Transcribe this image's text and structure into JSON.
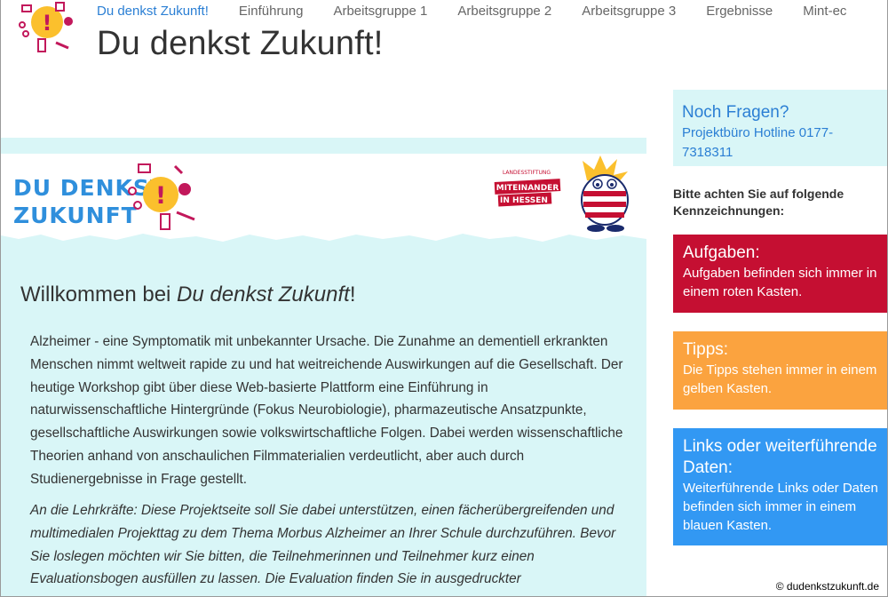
{
  "nav": {
    "items": [
      {
        "label": "Du denkst Zukunft!",
        "active": true
      },
      {
        "label": "Einführung"
      },
      {
        "label": "Arbeitsgruppe 1"
      },
      {
        "label": "Arbeitsgruppe 2"
      },
      {
        "label": "Arbeitsgruppe 3"
      },
      {
        "label": "Ergebnisse"
      },
      {
        "label": "Mint-ec"
      }
    ]
  },
  "header": {
    "title": "Du denkst Zukunft!"
  },
  "banner": {
    "logo_line1": "DU DENKST",
    "logo_line2": "ZUKUNFT",
    "partner_small": "LANDESSTIFTUNG",
    "partner_line1": "MITEINANDER",
    "partner_line2": "IN HESSEN"
  },
  "main": {
    "welcome_prefix": "Willkommen bei ",
    "welcome_em": "Du denkst Zukunft",
    "welcome_suffix": "!",
    "paragraph1": "Alzheimer - eine Symptomatik mit unbekannter Ursache. Die Zunahme an dementiell erkrankten Menschen nimmt weltweit rapide zu und hat weitreichende Auswirkungen auf die Gesellschaft. Der heutige Workshop gibt über diese Web-basierte Plattform eine Einführung in naturwissenschaftliche Hintergründe (Fokus Neurobiologie), pharmazeutische Ansatzpunkte, gesellschaftliche Auswirkungen sowie volkswirtschaftliche Folgen. Dabei werden wissenschaftliche Theorien anhand von anschaulichen Filmmaterialien verdeutlicht, aber auch durch Studienergebnisse in Frage gestellt.",
    "paragraph2": "An die Lehrkräfte: Diese Projektseite soll Sie dabei unterstützen, einen fächerübergreifenden und multimedialen Projekttag zu dem Thema Morbus Alzheimer an Ihrer Schule durchzuführen. Bevor Sie loslegen möchten wir Sie bitten, die Teilnehmerinnen und Teilnehmer kurz einen Evaluationsbogen ausfüllen zu lassen. Die Evaluation finden Sie in ausgedruckter"
  },
  "sidebar": {
    "faq_title": "Noch Fragen?",
    "faq_text": "Projektbüro Hotline 0177-7318311",
    "note": "Bitte achten Sie auf folgende Kennzeichnungen:",
    "boxes": [
      {
        "title": "Aufgaben:",
        "text": "Aufgaben befinden sich immer in einem roten Kasten.",
        "color": "#c50f32"
      },
      {
        "title": "Tipps:",
        "text": "Die Tipps stehen immer in einem gelben Kasten.",
        "color": "#fba33f"
      },
      {
        "title": "Links oder weiterführende Daten:",
        "text": "Weiterführende Links oder Daten befinden sich immer in einem blauen Kasten.",
        "color": "#3298f3"
      }
    ]
  },
  "footer": {
    "copyright": "© dudenkstzukunft.de"
  },
  "colors": {
    "accent": "#2b7fd4",
    "light_cyan": "#d9f6f7"
  }
}
